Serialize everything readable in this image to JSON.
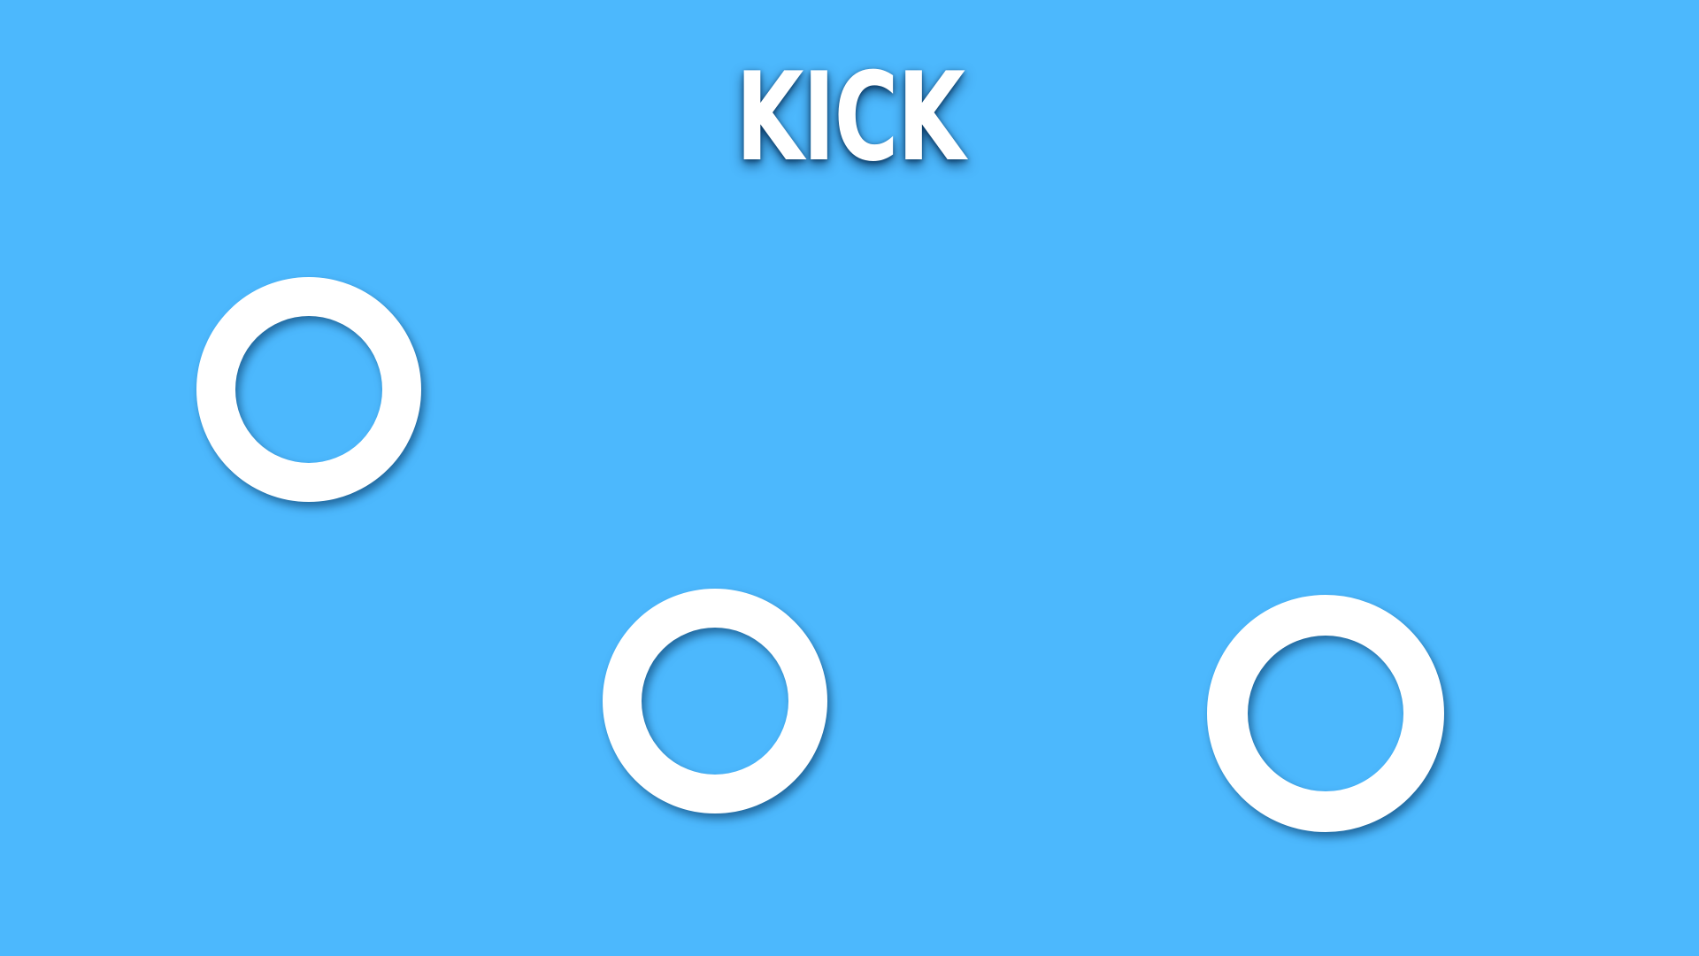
{
  "game": {
    "prompt_word": "KICK",
    "background_color": "#4cb8fd",
    "accent_color": "#ffffff",
    "targets": [
      {
        "name": "ring-target",
        "icon": "ring-icon"
      },
      {
        "name": "ring-target",
        "icon": "ring-icon"
      },
      {
        "name": "ring-target",
        "icon": "ring-icon"
      }
    ]
  }
}
